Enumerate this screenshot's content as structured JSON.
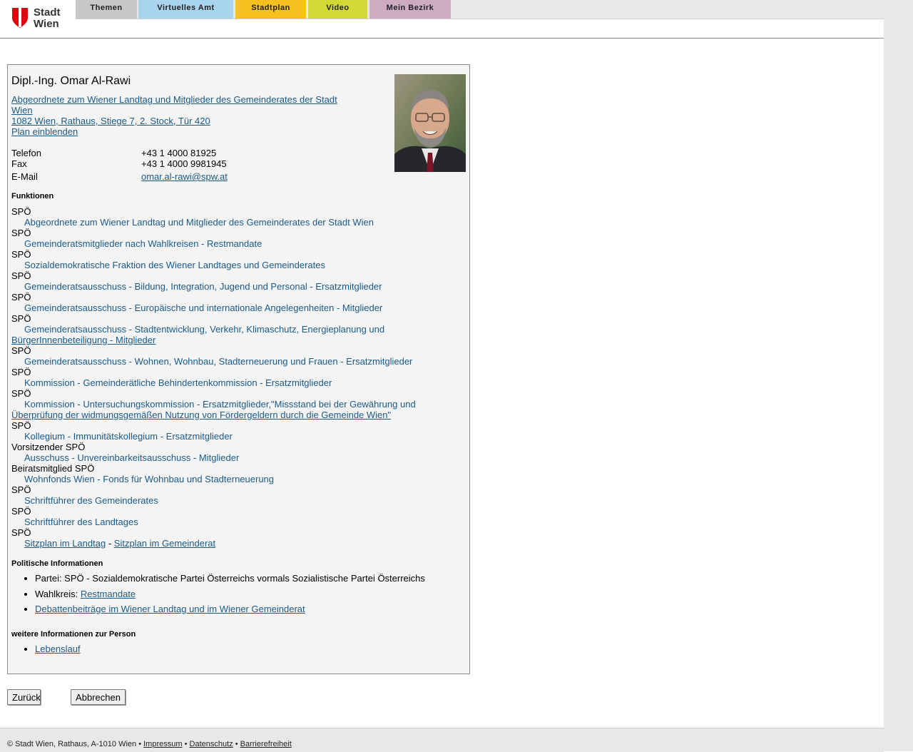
{
  "brand": {
    "line1": "Stadt",
    "line2": "Wien"
  },
  "nav": [
    "Themen",
    "Virtuelles Amt",
    "Stadtplan",
    "Video",
    "Mein Bezirk"
  ],
  "nav_colors": [
    "#c8c8c8",
    "#a8d4ee",
    "#f6c11e",
    "#d3d934",
    "#cfaac3"
  ],
  "person": {
    "name": "Dipl.-Ing. Omar Al-Rawi",
    "org_link_line1": "Abgeordnete zum Wiener Landtag und Mitglieder des Gemeinderates der Stadt",
    "org_link_line2": "Wien",
    "address": "1082 Wien, Rathaus, Stiege 7, 2. Stock, Tür 420",
    "plan_link": "Plan einblenden",
    "contact": [
      {
        "label": "Telefon",
        "value": "+43 1 4000 81925"
      },
      {
        "label": "Fax",
        "value": "+43 1 4000 9981945"
      },
      {
        "label": "E-Mail",
        "value": "omar.al-rawi@spw.at"
      }
    ]
  },
  "functions_title": "Funktionen",
  "functions": [
    {
      "role": "SPÖ",
      "link": "Abgeordnete zum Wiener Landtag und Mitglieder des Gemeinderates der Stadt Wien"
    },
    {
      "role": "SPÖ",
      "link": "Gemeinderatsmitglieder nach Wahlkreisen - Restmandate"
    },
    {
      "role": "SPÖ",
      "link": "Sozialdemokratische Fraktion des Wiener Landtages und Gemeinderates"
    },
    {
      "role": "SPÖ",
      "link": "Gemeinderatsausschuss - Bildung, Integration, Jugend und Personal - Ersatzmitglieder"
    },
    {
      "role": "SPÖ",
      "link": "Gemeinderatsausschuss - Europäische und internationale Angelegenheiten - Mitglieder"
    },
    {
      "role": "SPÖ",
      "link": "Gemeinderatsausschuss - Stadtentwicklung, Verkehr, Klimaschutz, Energieplanung und",
      "link2": "BürgerInnenbeteiligung - Mitglieder"
    },
    {
      "role": "SPÖ",
      "link": "Gemeinderatsausschuss - Wohnen, Wohnbau, Stadterneuerung und Frauen - Ersatzmitglieder"
    },
    {
      "role": "SPÖ",
      "link": "Kommission - Gemeinderätliche Behindertenkommission - Ersatzmitglieder"
    },
    {
      "role": "SPÖ",
      "link": "Kommission - Untersuchungskommission - Ersatzmitglieder,\"Missstand bei der Gewährung und",
      "link2": "Überprüfung der widmungsgemäßen Nutzung von Fördergeldern durch die Gemeinde Wien\""
    },
    {
      "role": "SPÖ",
      "link": "Kollegium - Immunitätskollegium - Ersatzmitglieder"
    },
    {
      "role": "Vorsitzender SPÖ",
      "link": "Ausschuss - Unvereinbarkeitsausschuss - Mitglieder"
    },
    {
      "role": "Beiratsmitglied SPÖ",
      "link": "Wohnfonds Wien - Fonds für Wohnbau und Stadterneuerung"
    },
    {
      "role": "SPÖ",
      "link": "Schriftführer des Gemeinderates"
    },
    {
      "role": "SPÖ",
      "link": "Schriftführer des Landtages"
    }
  ],
  "seating": {
    "role": "SPÖ",
    "link1": "Sitzplan im Landtag",
    "sep": "-",
    "link2": "Sitzplan im Gemeinderat"
  },
  "political_title": "Politische Informationen",
  "political": {
    "party": "Partei: SPÖ - Sozialdemokratische Partei Österreichs vormals Sozialistische Partei Österreichs",
    "wahlkreis_label": "Wahlkreis:",
    "wahlkreis_link": "Restmandate",
    "debate_link": "Debattenbeiträge im Wiener Landtag und im Wiener Gemeinderat"
  },
  "more_title": "weitere Informationen zur Person",
  "more_link": "Lebenslauf",
  "buttons": {
    "back": "Zurück",
    "cancel": "Abbrechen"
  },
  "footer": {
    "copyright": "© Stadt Wien, Rathaus, A-1010 Wien",
    "sep": "•",
    "links": [
      "Impressum",
      "Datenschutz",
      "Barrierefreiheit"
    ]
  }
}
